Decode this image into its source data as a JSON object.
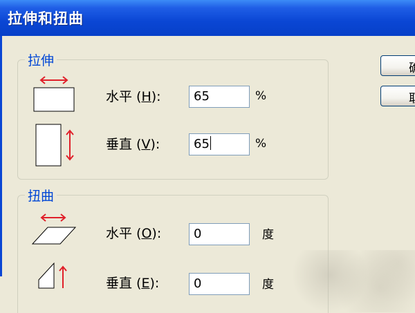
{
  "window": {
    "title": "拉伸和扭曲"
  },
  "stretch": {
    "legend": "拉伸",
    "horizontal": {
      "label_prefix": "水平 (",
      "hotkey": "H",
      "label_suffix": "):",
      "value": "65",
      "unit": "%"
    },
    "vertical": {
      "label_prefix": "垂直 (",
      "hotkey": "V",
      "label_suffix": "):",
      "value": "65",
      "unit": "%"
    }
  },
  "skew": {
    "legend": "扭曲",
    "horizontal": {
      "label_prefix": "水平 (",
      "hotkey": "O",
      "label_suffix": "):",
      "value": "0",
      "unit": "度"
    },
    "vertical": {
      "label_prefix": "垂直 (",
      "hotkey": "E",
      "label_suffix": "):",
      "value": "0",
      "unit": "度"
    }
  },
  "buttons": {
    "ok_label": "确",
    "cancel_label": "取"
  },
  "colors": {
    "title_bar": "#0a46d4",
    "arrow": "#e0202a",
    "group_label": "#0046d5"
  },
  "icons": {
    "stretch_horizontal": "stretch-horizontal-icon",
    "stretch_vertical": "stretch-vertical-icon",
    "skew_horizontal": "skew-horizontal-icon",
    "skew_vertical": "skew-vertical-icon"
  }
}
